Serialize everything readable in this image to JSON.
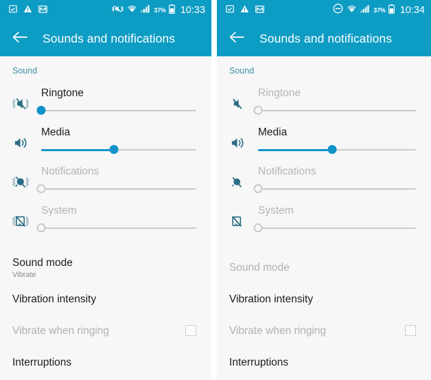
{
  "colors": {
    "accent": "#0d9cc4",
    "slider_active": "#1193c9",
    "section_header": "#3d8ea3",
    "icon": "#2a6c84",
    "icon_dim": "#b4b4b4",
    "text": "#1c1c1c",
    "text_dim": "#b0b0b0",
    "background": "#f7f7f7"
  },
  "panels": [
    {
      "id": "left",
      "statusbar": {
        "notification_icons": [
          "screenshot-icon",
          "warning-triangle-icon",
          "gmail-icon"
        ],
        "system_icons": [
          "vibrate-mute-icon",
          "wifi-icon",
          "signal-icon"
        ],
        "battery_percent": "37%",
        "clock": "10:33"
      },
      "appbar": {
        "back_label": "back-arrow",
        "title": "Sounds and notifications"
      },
      "section_header": "Sound",
      "volumes": [
        {
          "label": "Ringtone",
          "icon": "ringtone-vibrate-muted-icon",
          "value": 0,
          "enabled": true,
          "dim_label": false,
          "vibrate_marks": true
        },
        {
          "label": "Media",
          "icon": "media-volume-icon",
          "value": 47,
          "enabled": true,
          "dim_label": false,
          "vibrate_marks": false
        },
        {
          "label": "Notifications",
          "icon": "notifications-muted-icon",
          "value": 0,
          "enabled": false,
          "dim_label": true,
          "vibrate_marks": true
        },
        {
          "label": "System",
          "icon": "system-muted-icon",
          "value": 0,
          "enabled": false,
          "dim_label": true,
          "vibrate_marks": true
        }
      ],
      "rows": [
        {
          "title": "Sound mode",
          "subtitle": "Vibrate",
          "dim": false,
          "checkbox": false
        },
        {
          "title": "Vibration intensity",
          "subtitle": "",
          "dim": false,
          "checkbox": false
        },
        {
          "title": "Vibrate when ringing",
          "subtitle": "",
          "dim": true,
          "checkbox": true,
          "checked": false
        },
        {
          "title": "Interruptions",
          "subtitle": "",
          "dim": false,
          "checkbox": false
        }
      ]
    },
    {
      "id": "right",
      "statusbar": {
        "notification_icons": [
          "screenshot-icon",
          "warning-triangle-icon",
          "gmail-icon"
        ],
        "system_icons": [
          "do-not-disturb-icon",
          "wifi-icon",
          "signal-icon"
        ],
        "battery_percent": "37%",
        "clock": "10:34"
      },
      "appbar": {
        "back_label": "back-arrow",
        "title": "Sounds and notifications"
      },
      "section_header": "Sound",
      "volumes": [
        {
          "label": "Ringtone",
          "icon": "ringtone-muted-icon",
          "value": 0,
          "enabled": false,
          "dim_label": true,
          "vibrate_marks": false
        },
        {
          "label": "Media",
          "icon": "media-volume-icon",
          "value": 47,
          "enabled": true,
          "dim_label": false,
          "vibrate_marks": false
        },
        {
          "label": "Notifications",
          "icon": "notifications-muted-icon",
          "value": 0,
          "enabled": false,
          "dim_label": true,
          "vibrate_marks": false
        },
        {
          "label": "System",
          "icon": "system-muted-icon",
          "value": 0,
          "enabled": false,
          "dim_label": true,
          "vibrate_marks": false
        }
      ],
      "rows": [
        {
          "title": "Sound mode",
          "subtitle": "",
          "dim": true,
          "checkbox": false
        },
        {
          "title": "Vibration intensity",
          "subtitle": "",
          "dim": false,
          "checkbox": false
        },
        {
          "title": "Vibrate when ringing",
          "subtitle": "",
          "dim": true,
          "checkbox": true,
          "checked": false
        },
        {
          "title": "Interruptions",
          "subtitle": "",
          "dim": false,
          "checkbox": false
        }
      ]
    }
  ]
}
